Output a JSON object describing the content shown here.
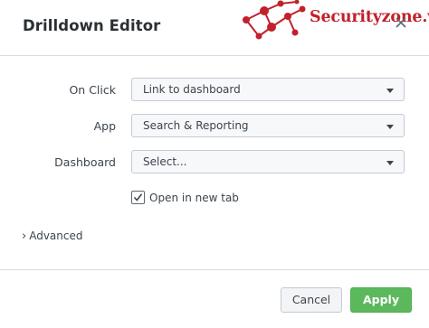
{
  "dialog": {
    "title": "Drilldown Editor",
    "close_icon": "close-icon",
    "watermark_text": "Securityzone.vn"
  },
  "form": {
    "on_click": {
      "label": "On Click",
      "value": "Link to dashboard"
    },
    "app": {
      "label": "App",
      "value": "Search & Reporting"
    },
    "dashboard": {
      "label": "Dashboard",
      "value": "Select..."
    },
    "new_tab": {
      "label": "Open in new tab",
      "checked": true
    },
    "advanced": {
      "label": "Advanced"
    }
  },
  "footer": {
    "cancel_label": "Cancel",
    "apply_label": "Apply"
  },
  "colors": {
    "apply": "#5cb85c",
    "watermark": "#c1212b"
  }
}
